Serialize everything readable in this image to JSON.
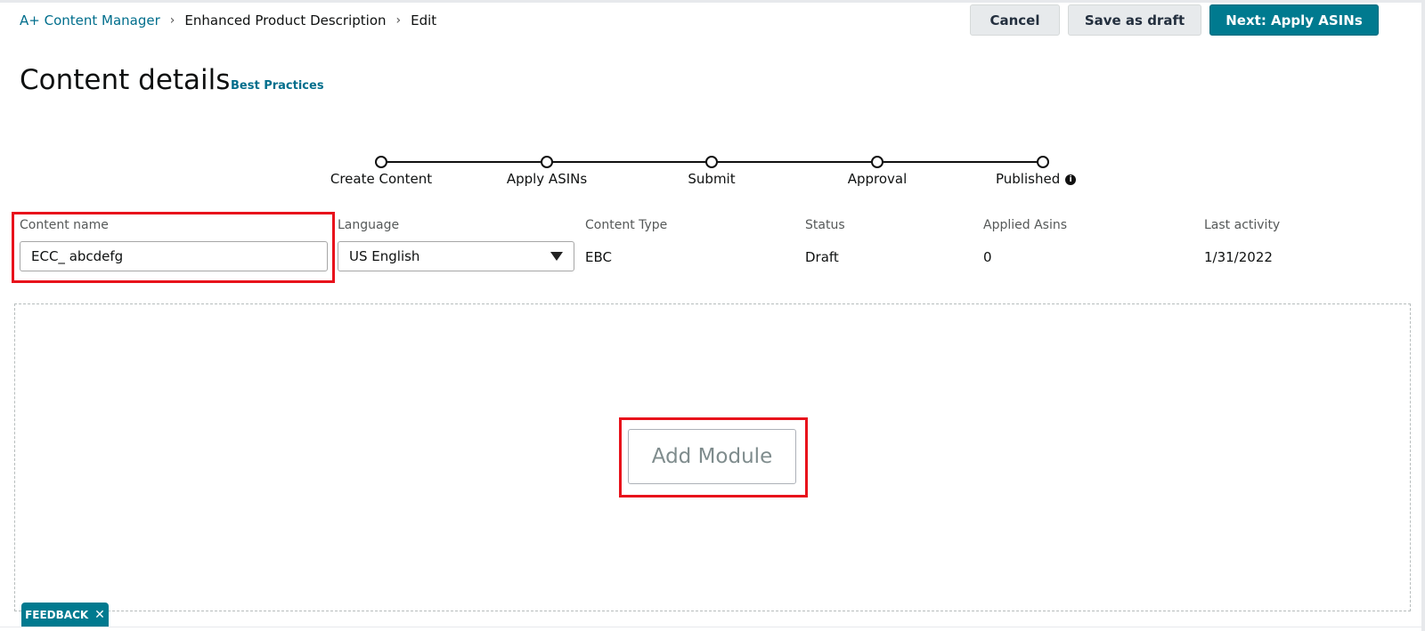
{
  "breadcrumb": {
    "root": "A+ Content Manager",
    "middle": "Enhanced Product Description",
    "current": "Edit",
    "separator": "›"
  },
  "toolbar": {
    "cancel_label": "Cancel",
    "save_draft_label": "Save as draft",
    "next_label": "Next: Apply ASINs"
  },
  "header": {
    "title": "Content details",
    "best_practices_link": "Best Practices"
  },
  "stepper": {
    "steps": [
      {
        "label": "Create Content"
      },
      {
        "label": "Apply ASINs"
      },
      {
        "label": "Submit"
      },
      {
        "label": "Approval"
      },
      {
        "label": "Published"
      }
    ],
    "info_glyph": "i"
  },
  "details": {
    "content_name": {
      "label": "Content name",
      "value": "ECC_ abcdefg"
    },
    "language": {
      "label": "Language",
      "value": "US English"
    },
    "content_type": {
      "label": "Content Type",
      "value": "EBC"
    },
    "status": {
      "label": "Status",
      "value": "Draft"
    },
    "applied_asins": {
      "label": "Applied Asins",
      "value": "0"
    },
    "last_activity": {
      "label": "Last activity",
      "value": "1/31/2022"
    }
  },
  "module_area": {
    "add_module_label": "Add Module"
  },
  "feedback": {
    "label": "FEEDBACK",
    "close_glyph": "✕"
  },
  "colors": {
    "accent": "#007a8f",
    "link": "#006e8c",
    "highlight": "#e8111b"
  }
}
